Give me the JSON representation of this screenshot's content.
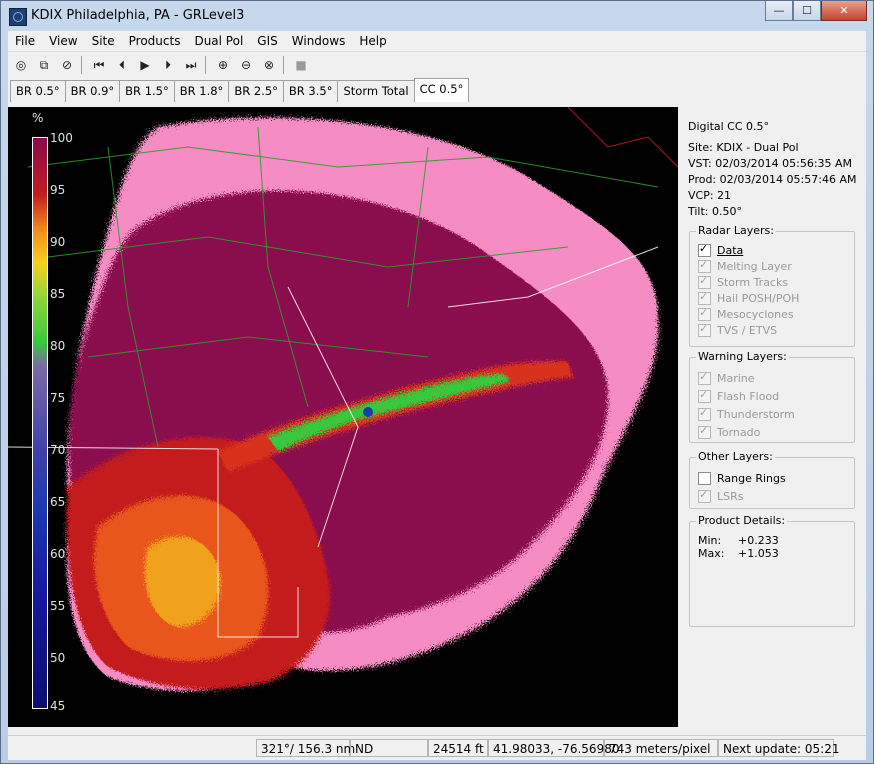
{
  "window": {
    "title": "KDIX Philadelphia, PA - GRLevel3",
    "minimize_glyph": "—",
    "maximize_glyph": "☐",
    "close_glyph": "✕"
  },
  "menu": [
    "File",
    "View",
    "Site",
    "Products",
    "Dual Pol",
    "GIS",
    "Windows",
    "Help"
  ],
  "toolbar": {
    "icons": [
      "products-icon",
      "copy-icon",
      "stop-record-icon",
      "first-frame-icon",
      "prev-frame-icon",
      "play-icon",
      "next-frame-icon",
      "last-frame-icon",
      "zoom-in-icon",
      "zoom-out-icon",
      "zoom-reset-icon",
      "pause-disabled-icon"
    ],
    "glyphs": [
      "◎",
      "⧉",
      "⊘",
      "⏮",
      "⏴",
      "▶",
      "⏵",
      "⏭",
      "⊕",
      "⊖",
      "⊗",
      "■"
    ]
  },
  "tabs": [
    "BR 0.5°",
    "BR 0.9°",
    "BR 1.5°",
    "BR 1.8°",
    "BR 2.5°",
    "BR 3.5°",
    "Storm Total",
    "CC 0.5°"
  ],
  "active_tab": "CC 0.5°",
  "legend": {
    "unit": "%",
    "ticks": [
      "100",
      "95",
      "90",
      "85",
      "80",
      "75",
      "70",
      "65",
      "60",
      "55",
      "50",
      "45"
    ]
  },
  "info": {
    "product": "Digital CC 0.5°",
    "site_label": "Site:",
    "site": "KDIX - Dual Pol",
    "vst_label": "VST:",
    "vst": "02/03/2014  05:56:35 AM",
    "prod_label": "Prod:",
    "prod": "02/03/2014  05:57:46 AM",
    "vcp_label": "VCP:",
    "vcp": "21",
    "tilt_label": "Tilt:",
    "tilt": "0.50°"
  },
  "radar_layers": {
    "caption": "Radar Layers:",
    "items": [
      {
        "label": "Data",
        "checked": true,
        "enabled": true
      },
      {
        "label": "Melting Layer",
        "checked": true,
        "enabled": false
      },
      {
        "label": "Storm Tracks",
        "checked": true,
        "enabled": false
      },
      {
        "label": "Hail POSH/POH",
        "checked": true,
        "enabled": false
      },
      {
        "label": "Mesocyclones",
        "checked": true,
        "enabled": false
      },
      {
        "label": "TVS / ETVS",
        "checked": true,
        "enabled": false
      }
    ]
  },
  "warning_layers": {
    "caption": "Warning Layers:",
    "items": [
      {
        "label": "Marine",
        "checked": true,
        "enabled": false
      },
      {
        "label": "Flash Flood",
        "checked": true,
        "enabled": false
      },
      {
        "label": "Thunderstorm",
        "checked": true,
        "enabled": false
      },
      {
        "label": "Tornado",
        "checked": true,
        "enabled": false
      }
    ]
  },
  "other_layers": {
    "caption": "Other Layers:",
    "items": [
      {
        "label": "Range Rings",
        "checked": false,
        "enabled": true
      },
      {
        "label": "LSRs",
        "checked": true,
        "enabled": false
      }
    ]
  },
  "product_details": {
    "caption": "Product Details:",
    "min_label": "Min:",
    "min": "+0.233",
    "max_label": "Max:",
    "max": "+1.053"
  },
  "status": {
    "bearing": "321°/ 156.3 nm",
    "value": "ND",
    "height": "24514 ft",
    "coords": "41.98033, -76.56980",
    "scale": "743 meters/pixel",
    "next_update": "Next update: 05:21"
  },
  "colors": {
    "high_cc": "#8a0a4e",
    "pink": "#f58cc3",
    "red": "#c41e1e",
    "orange": "#f08a1a",
    "yellow": "#f5d21e",
    "green": "#38c83c",
    "blue": "#1a3ab0"
  }
}
